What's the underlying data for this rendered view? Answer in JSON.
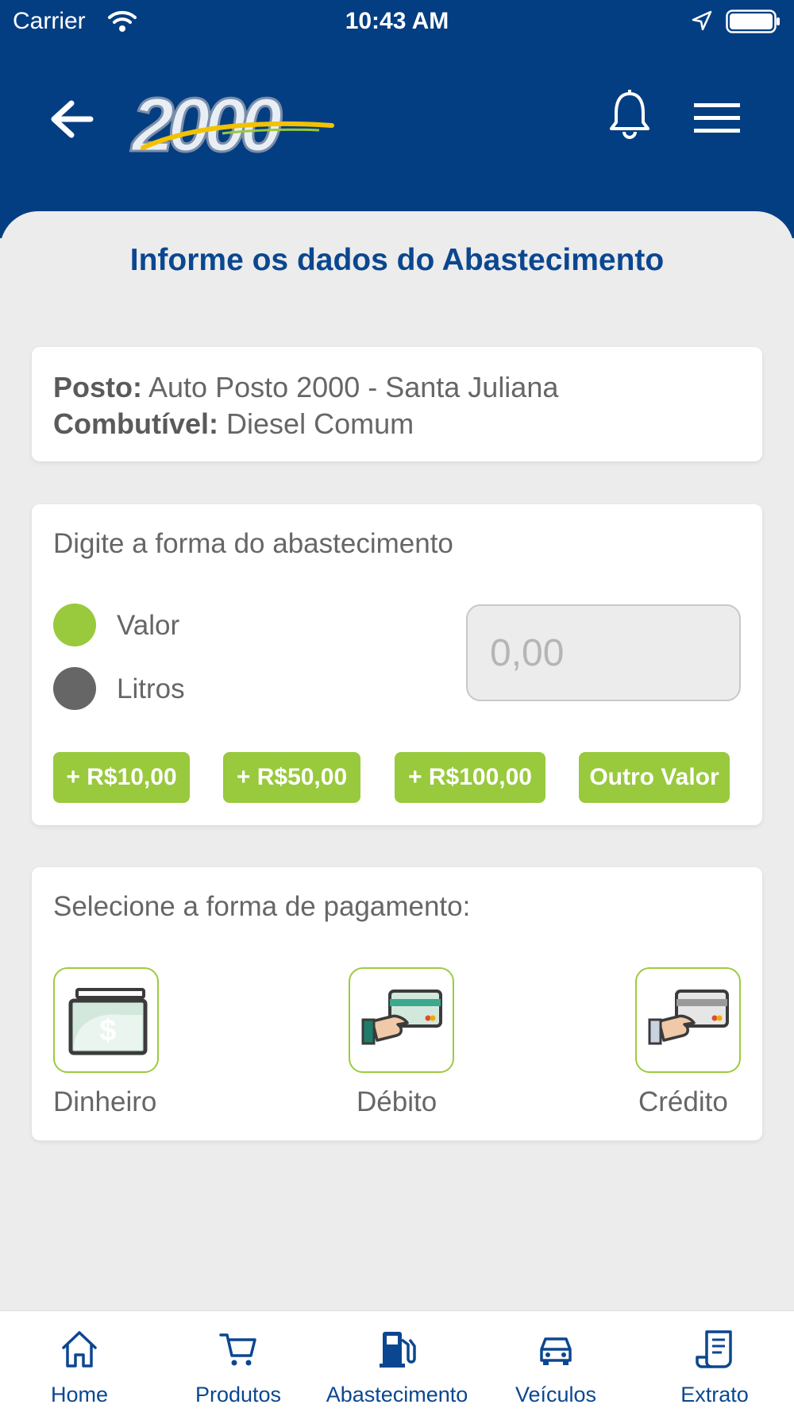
{
  "status_bar": {
    "carrier": "Carrier",
    "time": "10:43 AM"
  },
  "header": {
    "logo_text": "2000"
  },
  "main": {
    "title": "Informe os dados do Abastecimento",
    "info": {
      "posto_label": "Posto:",
      "posto_value": "Auto Posto 2000 - Santa Juliana",
      "combustivel_label": "Combutível:",
      "combustivel_value": "Diesel Comum"
    },
    "fill": {
      "title": "Digite a forma do abastecimento",
      "options": [
        {
          "label": "Valor",
          "selected": true,
          "color": "#99c93c"
        },
        {
          "label": "Litros",
          "selected": false,
          "color": "#666666"
        }
      ],
      "input_placeholder": "0,00",
      "quick_buttons": [
        "+ R$10,00",
        "+ R$50,00",
        "+ R$100,00",
        "Outro Valor"
      ]
    },
    "payment": {
      "title": "Selecione a forma de pagamento:",
      "options": [
        {
          "label": "Dinheiro",
          "icon": "cash-icon"
        },
        {
          "label": "Débito",
          "icon": "debit-card-icon"
        },
        {
          "label": "Crédito",
          "icon": "credit-card-icon"
        }
      ]
    }
  },
  "bottom_nav": {
    "items": [
      {
        "label": "Home",
        "icon": "home-icon"
      },
      {
        "label": "Produtos",
        "icon": "cart-icon"
      },
      {
        "label": "Abastecimento",
        "icon": "fuel-pump-icon"
      },
      {
        "label": "Veículos",
        "icon": "car-icon"
      },
      {
        "label": "Extrato",
        "icon": "receipt-icon"
      }
    ]
  },
  "colors": {
    "brand_blue": "#043e82",
    "accent_green": "#99c93c",
    "title_blue": "#0b4790"
  }
}
